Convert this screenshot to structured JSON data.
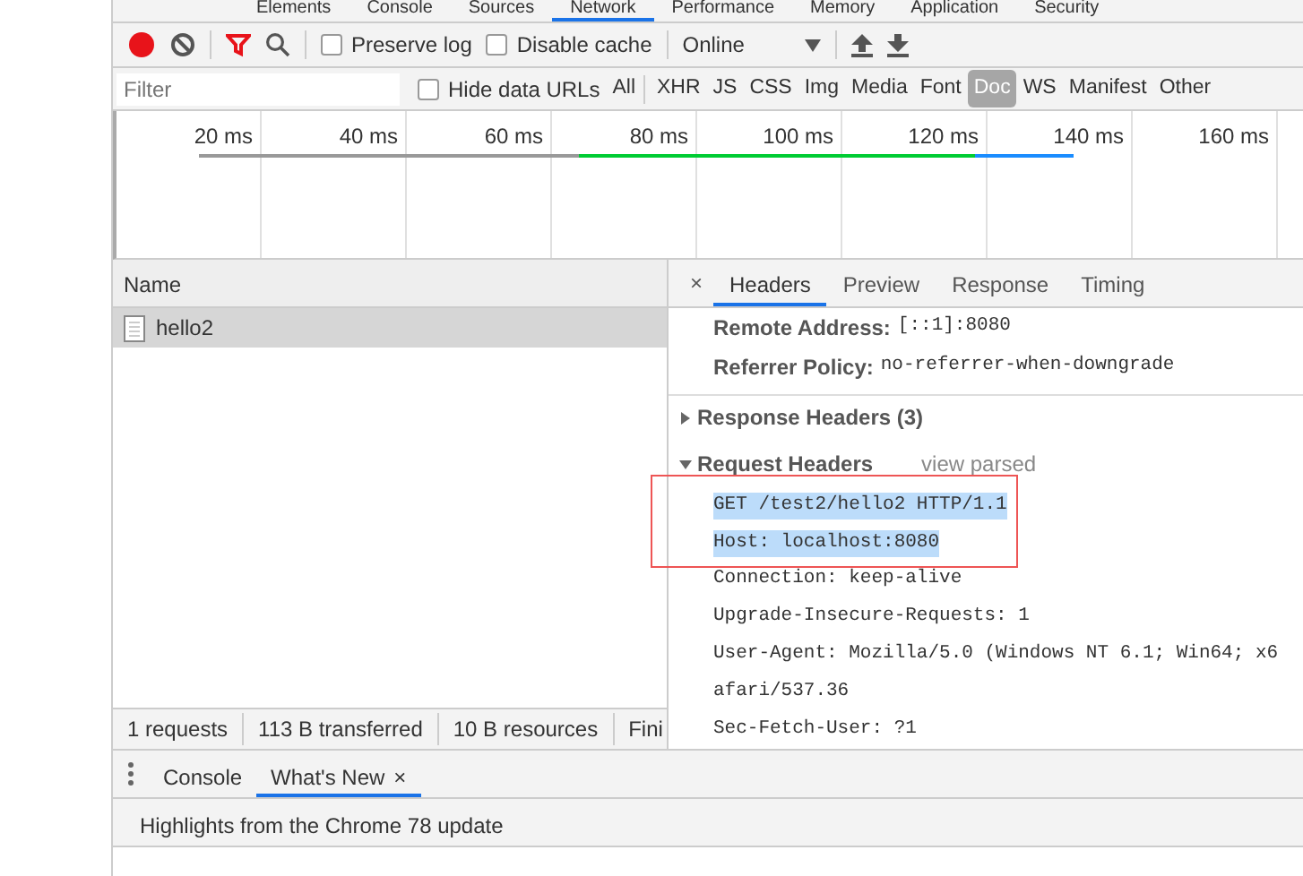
{
  "panel_tabs": [
    {
      "label": "Elements",
      "selected": false
    },
    {
      "label": "Console",
      "selected": false
    },
    {
      "label": "Sources",
      "selected": false
    },
    {
      "label": "Network",
      "selected": true
    },
    {
      "label": "Performance",
      "selected": false
    },
    {
      "label": "Memory",
      "selected": false
    },
    {
      "label": "Application",
      "selected": false
    },
    {
      "label": "Security",
      "selected": false
    }
  ],
  "toolbar": {
    "recording": true,
    "filter_active": true,
    "checkboxes": [
      {
        "label": "Preserve log",
        "checked": false
      },
      {
        "label": "Disable cache",
        "checked": false
      }
    ],
    "throttling": "Online"
  },
  "filter_bar": {
    "placeholder": "Filter",
    "hide_data_urls": {
      "label": "Hide data URLs",
      "checked": false
    },
    "types": [
      {
        "label": "All",
        "selected": false
      },
      {
        "label": "XHR",
        "selected": false
      },
      {
        "label": "JS",
        "selected": false
      },
      {
        "label": "CSS",
        "selected": false
      },
      {
        "label": "Img",
        "selected": false
      },
      {
        "label": "Media",
        "selected": false
      },
      {
        "label": "Font",
        "selected": false
      },
      {
        "label": "Doc",
        "selected": true
      },
      {
        "label": "WS",
        "selected": false
      },
      {
        "label": "Manifest",
        "selected": false
      },
      {
        "label": "Other",
        "selected": false
      }
    ]
  },
  "timeline": {
    "ticks": [
      "20 ms",
      "40 ms",
      "60 ms",
      "80 ms",
      "100 ms",
      "120 ms",
      "140 ms",
      "160 ms"
    ]
  },
  "requests": {
    "column": "Name",
    "rows": [
      {
        "name": "hello2",
        "selected": true
      }
    ]
  },
  "summary": [
    "1 requests",
    "113 B transferred",
    "10 B resources",
    "Fini"
  ],
  "details": {
    "close": "×",
    "tabs": [
      {
        "label": "Headers",
        "selected": true
      },
      {
        "label": "Preview",
        "selected": false
      },
      {
        "label": "Response",
        "selected": false
      },
      {
        "label": "Timing",
        "selected": false
      }
    ],
    "general": [
      {
        "key": "Remote Address:",
        "value": "[::1]:8080"
      },
      {
        "key": "Referrer Policy:",
        "value": "no-referrer-when-downgrade"
      }
    ],
    "sections": [
      {
        "title": "Response Headers (3)",
        "expanded": false
      },
      {
        "title": "Request Headers",
        "expanded": true,
        "link": "view parsed",
        "lines": [
          {
            "text": "GET /test2/hello2 HTTP/1.1",
            "highlighted": true
          },
          {
            "text": "Host: localhost:8080",
            "highlighted": true
          },
          {
            "text": "Connection: keep-alive",
            "highlighted": false
          },
          {
            "text": "Upgrade-Insecure-Requests: 1",
            "highlighted": false
          },
          {
            "text": "User-Agent: Mozilla/5.0 (Windows NT 6.1; Win64; x6",
            "highlighted": false
          },
          {
            "text": "afari/537.36",
            "highlighted": false
          },
          {
            "text": "Sec-Fetch-User: ?1",
            "highlighted": false
          }
        ]
      }
    ]
  },
  "drawer": {
    "tabs": [
      {
        "label": "Console",
        "selected": false
      },
      {
        "label": "What's New",
        "selected": true,
        "close": "×"
      }
    ],
    "content": "Highlights from the Chrome 78 update"
  }
}
